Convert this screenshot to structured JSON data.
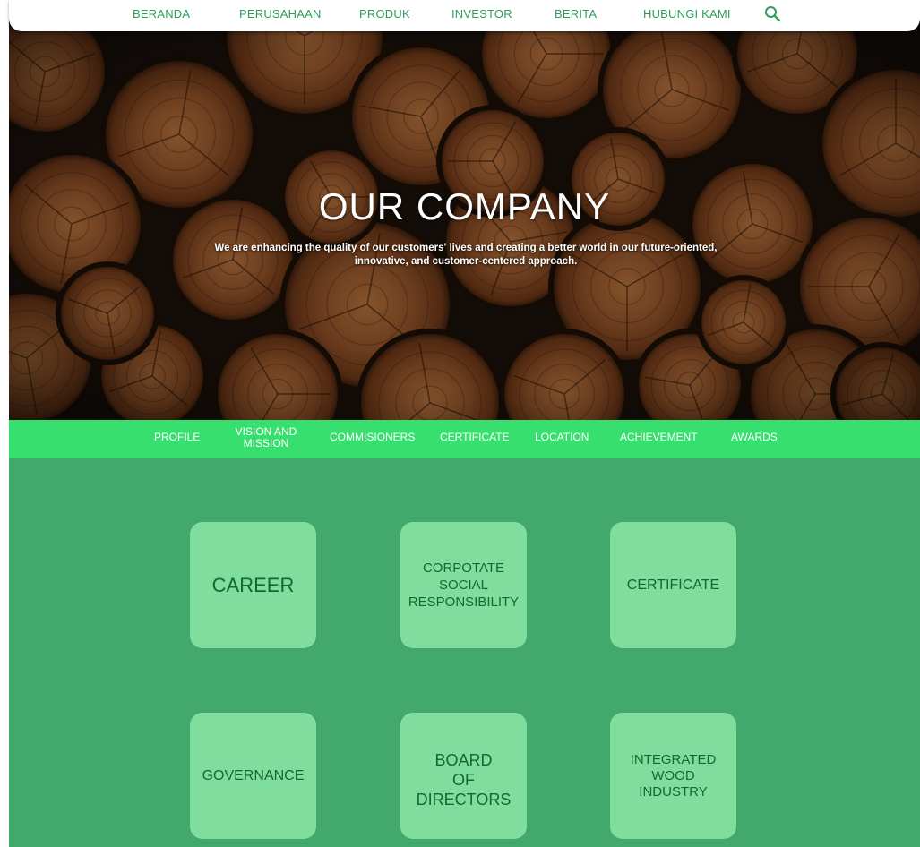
{
  "topnav": {
    "items": [
      "BERANDA",
      "PERUSAHAAN",
      "PRODUK",
      "INVESTOR",
      "BERITA",
      "HUBUNGI KAMI"
    ],
    "search_icon": "search-icon",
    "accent_color": "#2e9e5b"
  },
  "hero": {
    "title": "OUR COMPANY",
    "subtitle_line1": "We are enhancing the quality of our customers' lives and creating a better world in our future-oriented,",
    "subtitle_line2": "innovative, and customer-centered approach."
  },
  "subnav": {
    "background_color": "#37e06e",
    "items": [
      {
        "label": "PROFILE"
      },
      {
        "label": "VISION AND",
        "label2": "MISSION"
      },
      {
        "label": "COMMISIONERS"
      },
      {
        "label": "CERTIFICATE"
      },
      {
        "label": "LOCATION"
      },
      {
        "label": "ACHIEVEMENT"
      },
      {
        "label": "AWARDS"
      }
    ]
  },
  "content": {
    "background_color": "#42a86c",
    "card_color": "#7fdd9d",
    "cards": [
      {
        "lines": [
          "CAREER"
        ]
      },
      {
        "lines": [
          "CORPOTATE",
          "SOCIAL",
          "RESPONSIBILITY"
        ]
      },
      {
        "lines": [
          "CERTIFICATE"
        ]
      },
      {
        "lines": [
          "GOVERNANCE"
        ]
      },
      {
        "lines": [
          "BOARD",
          "OF",
          "DIRECTORS"
        ]
      },
      {
        "lines": [
          "INTEGRATED",
          "WOOD",
          "INDUSTRY"
        ]
      }
    ]
  }
}
